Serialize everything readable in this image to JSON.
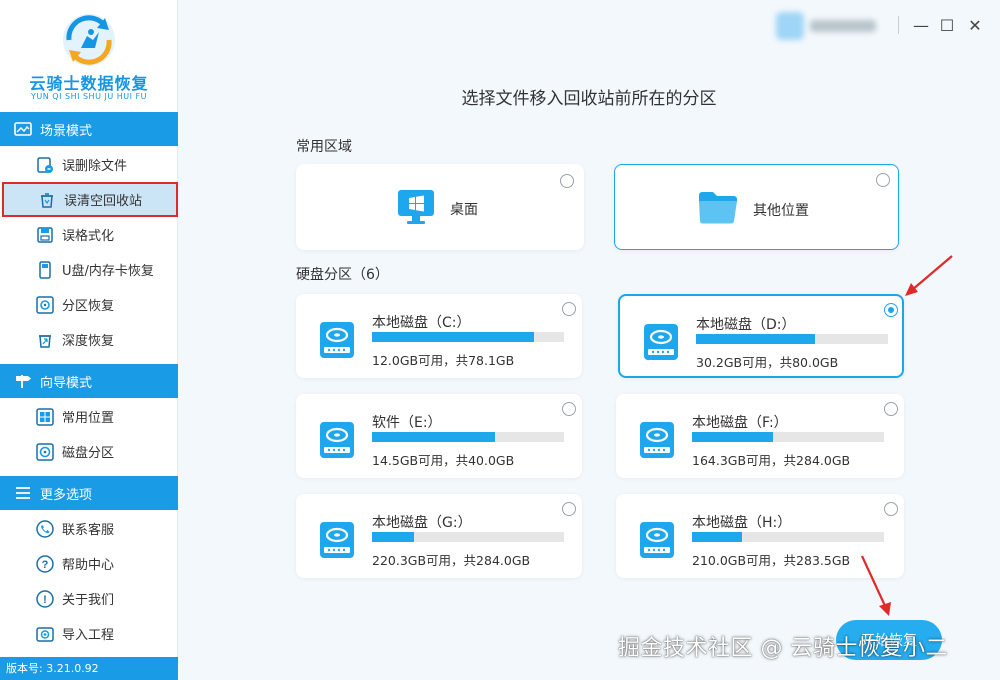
{
  "app": {
    "logo_title": "云骑士数据恢复",
    "logo_sub": "YUN QI SHI SHU JU HUI FU",
    "version": "版本号: 3.21.0.92"
  },
  "sidebar": {
    "sections": [
      {
        "title": "场景模式",
        "icon": "scene-icon",
        "items": [
          {
            "label": "误删除文件",
            "icon": "deleted-file-icon"
          },
          {
            "label": "误清空回收站",
            "icon": "recycle-bin-icon",
            "active": true
          },
          {
            "label": "误格式化",
            "icon": "format-icon"
          },
          {
            "label": "U盘/内存卡恢复",
            "icon": "usb-card-icon"
          },
          {
            "label": "分区恢复",
            "icon": "partition-icon"
          },
          {
            "label": "深度恢复",
            "icon": "deep-recovery-icon"
          }
        ]
      },
      {
        "title": "向导模式",
        "icon": "signpost-icon",
        "items": [
          {
            "label": "常用位置",
            "icon": "windows-icon"
          },
          {
            "label": "磁盘分区",
            "icon": "disk-icon"
          }
        ]
      },
      {
        "title": "更多选项",
        "icon": "menu-icon",
        "items": [
          {
            "label": "联系客服",
            "icon": "phone-icon"
          },
          {
            "label": "帮助中心",
            "icon": "help-icon"
          },
          {
            "label": "关于我们",
            "icon": "info-icon"
          },
          {
            "label": "导入工程",
            "icon": "import-icon"
          }
        ]
      }
    ]
  },
  "window": {
    "minimize": "—",
    "maximize": "☐",
    "close": "✕"
  },
  "main": {
    "title": "选择文件移入回收站前所在的分区",
    "common_label": "常用区域",
    "common": [
      {
        "label": "桌面",
        "icon": "desktop-icon",
        "selected": false
      },
      {
        "label": "其他位置",
        "icon": "folder-icon",
        "selected": false
      }
    ],
    "disks_label": "硬盘分区（6）",
    "disks": [
      {
        "name": "本地磁盘（C:）",
        "capacity": "12.0GB可用，共78.1GB",
        "used_fraction": 0.846,
        "selected": false
      },
      {
        "name": "本地磁盘（D:）",
        "capacity": "30.2GB可用，共80.0GB",
        "used_fraction": 0.62,
        "selected": true
      },
      {
        "name": "软件（E:）",
        "capacity": "14.5GB可用，共40.0GB",
        "used_fraction": 0.64,
        "selected": false
      },
      {
        "name": "本地磁盘（F:）",
        "capacity": "164.3GB可用，共284.0GB",
        "used_fraction": 0.42,
        "selected": false
      },
      {
        "name": "本地磁盘（G:）",
        "capacity": "220.3GB可用，共284.0GB",
        "used_fraction": 0.22,
        "selected": false
      },
      {
        "name": "本地磁盘（H:）",
        "capacity": "210.0GB可用，共283.5GB",
        "used_fraction": 0.26,
        "selected": false
      }
    ],
    "start_button": "开始恢复"
  },
  "watermark": "掘金技术社区 @ 云骑士恢复小二",
  "colors": {
    "accent": "#1a9be6",
    "bar": "#1ea7ec",
    "annotation": "#e02a2a"
  }
}
